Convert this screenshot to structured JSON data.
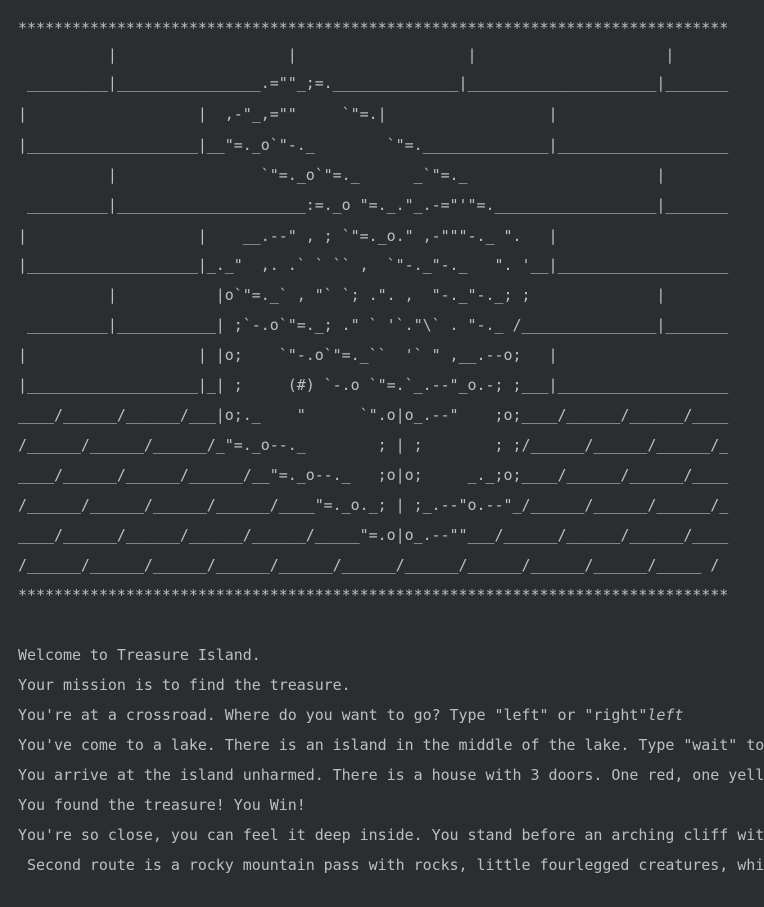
{
  "console": {
    "banner": [
      "*******************************************************************************",
      "          |                   |                   |                     |",
      " _________|________________.=\"\"_;=.______________|_____________________|_______",
      "|                   |  ,-\"_,=\"\"     `\"=.|                  |",
      "|___________________|__\"=._o`\"-._        `\"=.______________|___________________",
      "          |                `\"=._o`\"=._      _`\"=._                     |",
      " _________|_____________________:=._o \"=._.\"_.-=\"'\"=.__________________|_______",
      "|                   |    __.--\" , ; `\"=._o.\" ,-\"\"\"-._ \".   |",
      "|___________________|_._\"  ,. .` ` `` ,  `\"-._\"-._   \". '__|___________________",
      "          |           |o`\"=._` , \"` `; .\". ,  \"-._\"-._; ;              |",
      " _________|___________| ;`-.o`\"=._; .\" ` '`.\"\\` . \"-._ /_______________|_______",
      "|                   | |o;    `\"-.o`\"=._``  '` \" ,__.--o;   |",
      "|___________________|_| ;     (#) `-.o `\"=.`_.--\"_o.-; ;___|___________________",
      "____/______/______/___|o;._    \"      `\".o|o_.--\"    ;o;____/______/______/____",
      "/______/______/______/_\"=._o--._        ; | ;        ; ;/______/______/______/_",
      "____/______/______/______/__\"=._o--._   ;o|o;     _._;o;____/______/______/____",
      "/______/______/______/______/____\"=._o._; | ;_.--\"o.--\"_/______/______/______/_",
      "____/______/______/______/______/_____\"=.o|o_.--\"\"___/______/______/______/____",
      "/______/______/______/______/______/______/______/______/______/______/_____ /",
      "*******************************************************************************"
    ],
    "messages": {
      "welcome": "Welcome to Treasure Island.",
      "mission": "Your mission is to find the treasure.",
      "crossroad_prompt": "You're at a crossroad. Where do you want to go? Type \"left\" or \"right\"",
      "crossroad_input": "left",
      "lake": "You've come to a lake. There is an island in the middle of the lake. Type \"wait\" to",
      "island": "You arrive at the island unharmed. There is a house with 3 doors. One red, one yell",
      "win": "You found the treasure! You Win!",
      "cliff": "You're so close, you can feel it deep inside. You stand before an arching cliff wit",
      "second_route": " Second route is a rocky mountain pass with rocks, little fourlegged creatures, whi"
    }
  }
}
